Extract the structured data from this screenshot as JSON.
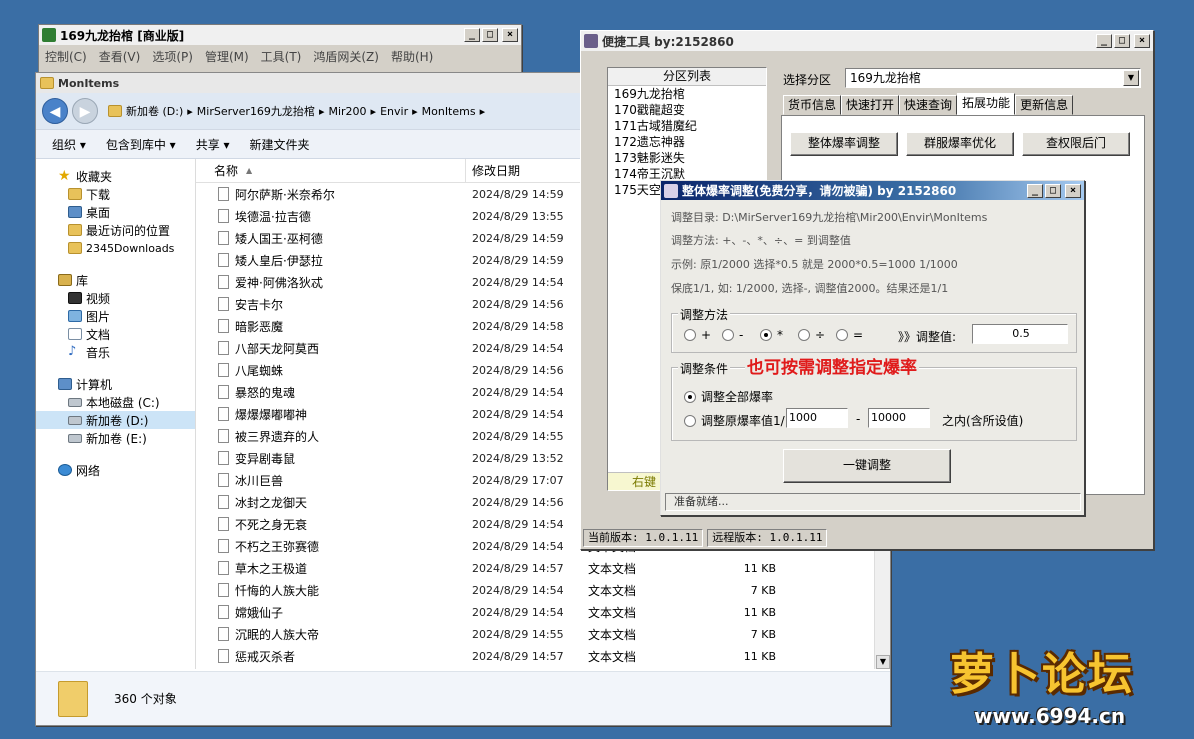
{
  "main_window": {
    "title": "169九龙抬棺 [商业版]",
    "menu": [
      "控制(C)",
      "查看(V)",
      "选项(P)",
      "管理(M)",
      "工具(T)",
      "鸿盾网关(Z)",
      "帮助(H)"
    ]
  },
  "explorer": {
    "title": "MonItems",
    "path": [
      "新加卷 (D:)",
      "MirServer169九龙抬棺",
      "Mir200",
      "Envir",
      "MonItems"
    ],
    "toolbar": [
      "组织 ▾",
      "包含到库中 ▾",
      "共享 ▾",
      "新建文件夹"
    ],
    "nav": {
      "favorites_header": "收藏夹",
      "favorites": [
        "下载",
        "桌面",
        "最近访问的位置",
        "2345Downloads"
      ],
      "libraries_header": "库",
      "libraries": [
        "视频",
        "图片",
        "文档",
        "音乐"
      ],
      "computer_header": "计算机",
      "drives": [
        "本地磁盘 (C:)",
        "新加卷 (D:)",
        "新加卷 (E:)"
      ],
      "network": "网络"
    },
    "columns": {
      "name": "名称",
      "date": "修改日期"
    },
    "files": [
      {
        "name": "阿尔萨斯·米奈希尔",
        "date": "2024/8/29 14:59",
        "type": "",
        "size": ""
      },
      {
        "name": "埃德温·拉吉德",
        "date": "2024/8/29 13:55",
        "type": "",
        "size": ""
      },
      {
        "name": "矮人国王·巫柯德",
        "date": "2024/8/29 14:59",
        "type": "",
        "size": ""
      },
      {
        "name": "矮人皇后·伊瑟拉",
        "date": "2024/8/29 14:59",
        "type": "",
        "size": ""
      },
      {
        "name": "爱神·阿佛洛狄忒",
        "date": "2024/8/29 14:54",
        "type": "",
        "size": ""
      },
      {
        "name": "安吉卡尔",
        "date": "2024/8/29 14:56",
        "type": "",
        "size": ""
      },
      {
        "name": "暗影恶魔",
        "date": "2024/8/29 14:58",
        "type": "",
        "size": ""
      },
      {
        "name": "八部天龙阿莫西",
        "date": "2024/8/29 14:54",
        "type": "",
        "size": ""
      },
      {
        "name": "八尾蜘蛛",
        "date": "2024/8/29 14:56",
        "type": "",
        "size": ""
      },
      {
        "name": "暴怒的鬼魂",
        "date": "2024/8/29 14:54",
        "type": "",
        "size": ""
      },
      {
        "name": "爆爆爆嘟嘟神",
        "date": "2024/8/29 14:54",
        "type": "",
        "size": ""
      },
      {
        "name": "被三界遗弃的人",
        "date": "2024/8/29 14:55",
        "type": "",
        "size": ""
      },
      {
        "name": "变异剧毒鼠",
        "date": "2024/8/29 13:52",
        "type": "",
        "size": ""
      },
      {
        "name": "冰川巨兽",
        "date": "2024/8/29 17:07",
        "type": "",
        "size": ""
      },
      {
        "name": "冰封之龙御天",
        "date": "2024/8/29 14:56",
        "type": "",
        "size": ""
      },
      {
        "name": "不死之身无衰",
        "date": "2024/8/29 14:54",
        "type": "",
        "size": ""
      },
      {
        "name": "不朽之王弥赛德",
        "date": "2024/8/29 14:54",
        "type": "文本文档",
        "size": "11 KB"
      },
      {
        "name": "草木之王极道",
        "date": "2024/8/29 14:57",
        "type": "文本文档",
        "size": "11 KB"
      },
      {
        "name": "忏悔的人族大能",
        "date": "2024/8/29 14:54",
        "type": "文本文档",
        "size": "7 KB"
      },
      {
        "name": "嫦娥仙子",
        "date": "2024/8/29 14:54",
        "type": "文本文档",
        "size": "11 KB"
      },
      {
        "name": "沉眠的人族大帝",
        "date": "2024/8/29 14:55",
        "type": "文本文档",
        "size": "7 KB"
      },
      {
        "name": "惩戒灭杀者",
        "date": "2024/8/29 14:57",
        "type": "文本文档",
        "size": "11 KB"
      }
    ],
    "status": "360 个对象"
  },
  "tool_window": {
    "title": "便捷工具  by:2152860",
    "partition_header": "分区列表",
    "partitions": [
      "169九龙抬棺",
      "170戳龍超变",
      "171古域猎魔纪",
      "172遗忘神器",
      "173魅影迷失",
      "174帝王沉默",
      "175天空之"
    ],
    "right_click_hint": "右键",
    "select_label": "选择分区",
    "selected_partition": "169九龙抬棺",
    "tabs": [
      "货币信息",
      "快速打开",
      "快速查询",
      "拓展功能",
      "更新信息"
    ],
    "buttons": [
      "整体爆率调整",
      "群服爆率优化",
      "查权限后门"
    ],
    "current_version": "当前版本: 1.0.1.11",
    "remote_version": "远程版本: 1.0.1.11"
  },
  "dialog": {
    "title": "整体爆率调整(免费分享，请勿被骗)   by 2152860",
    "dir_line": "调整目录: D:\\MirServer169九龙抬棺\\Mir200\\Envir\\MonItems",
    "method_line": "调整方法: +、-、*、÷、=  到调整值",
    "example_line": "示例: 原1/2000 选择*0.5 就是 2000*0.5=1000  1/1000",
    "keep_line": "保底1/1, 如: 1/2000, 选择-, 调整值2000。结果还是1/1",
    "method_group": "调整方法",
    "ops": [
      "+",
      "-",
      "*",
      "÷",
      "="
    ],
    "selected_op": "*",
    "adjust_label": "》》调整值:",
    "adjust_value": "0.5",
    "cond_group": "调整条件",
    "annotation": "也可按需调整指定爆率",
    "cond_all": "调整全部爆率",
    "cond_range": "调整原爆率值1/",
    "range_from": "1000",
    "range_dash": "-",
    "range_to": "10000",
    "range_suffix": "之内(含所设值)",
    "apply_button": "一键调整",
    "status": "准备就绪..."
  },
  "watermark": {
    "title": "萝卜论坛",
    "url": "www.6994.cn"
  }
}
